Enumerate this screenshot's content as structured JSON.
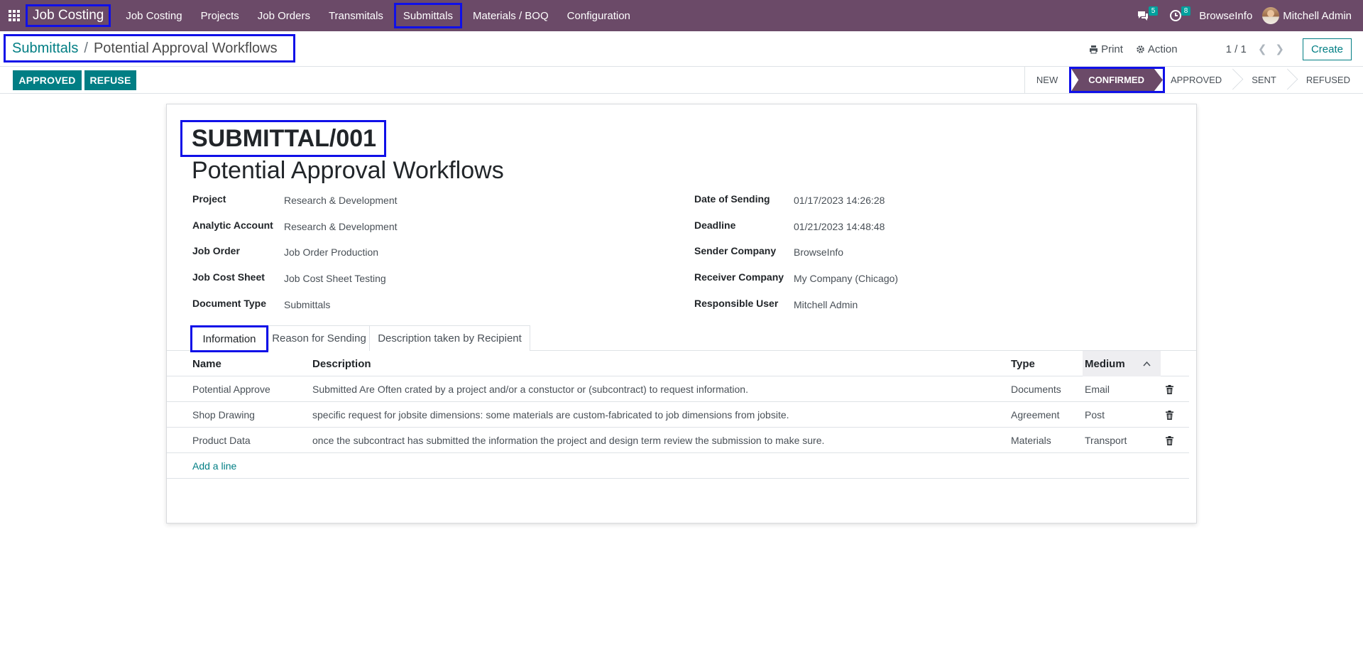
{
  "navbar": {
    "brand": "Job Costing",
    "menu": [
      "Job Costing",
      "Projects",
      "Job Orders",
      "Transmitals",
      "Submittals",
      "Materials / BOQ",
      "Configuration"
    ],
    "messages_count": "5",
    "activities_count": "8",
    "company": "BrowseInfo",
    "user": "Mitchell Admin"
  },
  "breadcrumb": {
    "parent": "Submittals",
    "separator": "/",
    "current": "Potential Approval Workflows"
  },
  "control": {
    "print": "Print",
    "action": "Action",
    "pager": "1 / 1",
    "create": "Create"
  },
  "buttons": {
    "approved": "APPROVED",
    "refuse": "REFUSE"
  },
  "stages": [
    "NEW",
    "CONFIRMED",
    "APPROVED",
    "SENT",
    "REFUSED"
  ],
  "current_stage": "CONFIRMED",
  "record": {
    "reference": "SUBMITTAL/001",
    "title": "Potential Approval Workflows",
    "left_fields": [
      {
        "label": "Project",
        "value": "Research & Development"
      },
      {
        "label": "Analytic Account",
        "value": "Research & Development"
      },
      {
        "label": "Job Order",
        "value": "Job Order Production"
      },
      {
        "label": "Job Cost Sheet",
        "value": "Job Cost Sheet Testing"
      },
      {
        "label": "Document Type",
        "value": "Submittals"
      }
    ],
    "right_fields": [
      {
        "label": "Date of Sending",
        "value": "01/17/2023 14:26:28"
      },
      {
        "label": "Deadline",
        "value": "01/21/2023 14:48:48"
      },
      {
        "label": "Sender Company",
        "value": "BrowseInfo"
      },
      {
        "label": "Receiver Company",
        "value": "My Company (Chicago)"
      },
      {
        "label": "Responsible User",
        "value": "Mitchell Admin"
      }
    ]
  },
  "tabs": [
    "Information",
    "Reason for Sending",
    "Description taken by Recipient"
  ],
  "table": {
    "headers": {
      "name": "Name",
      "description": "Description",
      "type": "Type",
      "medium": "Medium"
    },
    "rows": [
      {
        "name": "Potential Approve",
        "description": "Submitted Are Often crated by a project and/or a constuctor or (subcontract) to request information.",
        "type": "Documents",
        "medium": "Email"
      },
      {
        "name": "Shop Drawing",
        "description": "specific request for jobsite dimensions: some materials are custom-fabricated to job dimensions from jobsite.",
        "type": "Agreement",
        "medium": "Post"
      },
      {
        "name": "Product Data",
        "description": "once the subcontract has submitted the information the project and design term review the submission to make sure.",
        "type": "Materials",
        "medium": "Transport"
      }
    ],
    "add_line": "Add a line"
  }
}
